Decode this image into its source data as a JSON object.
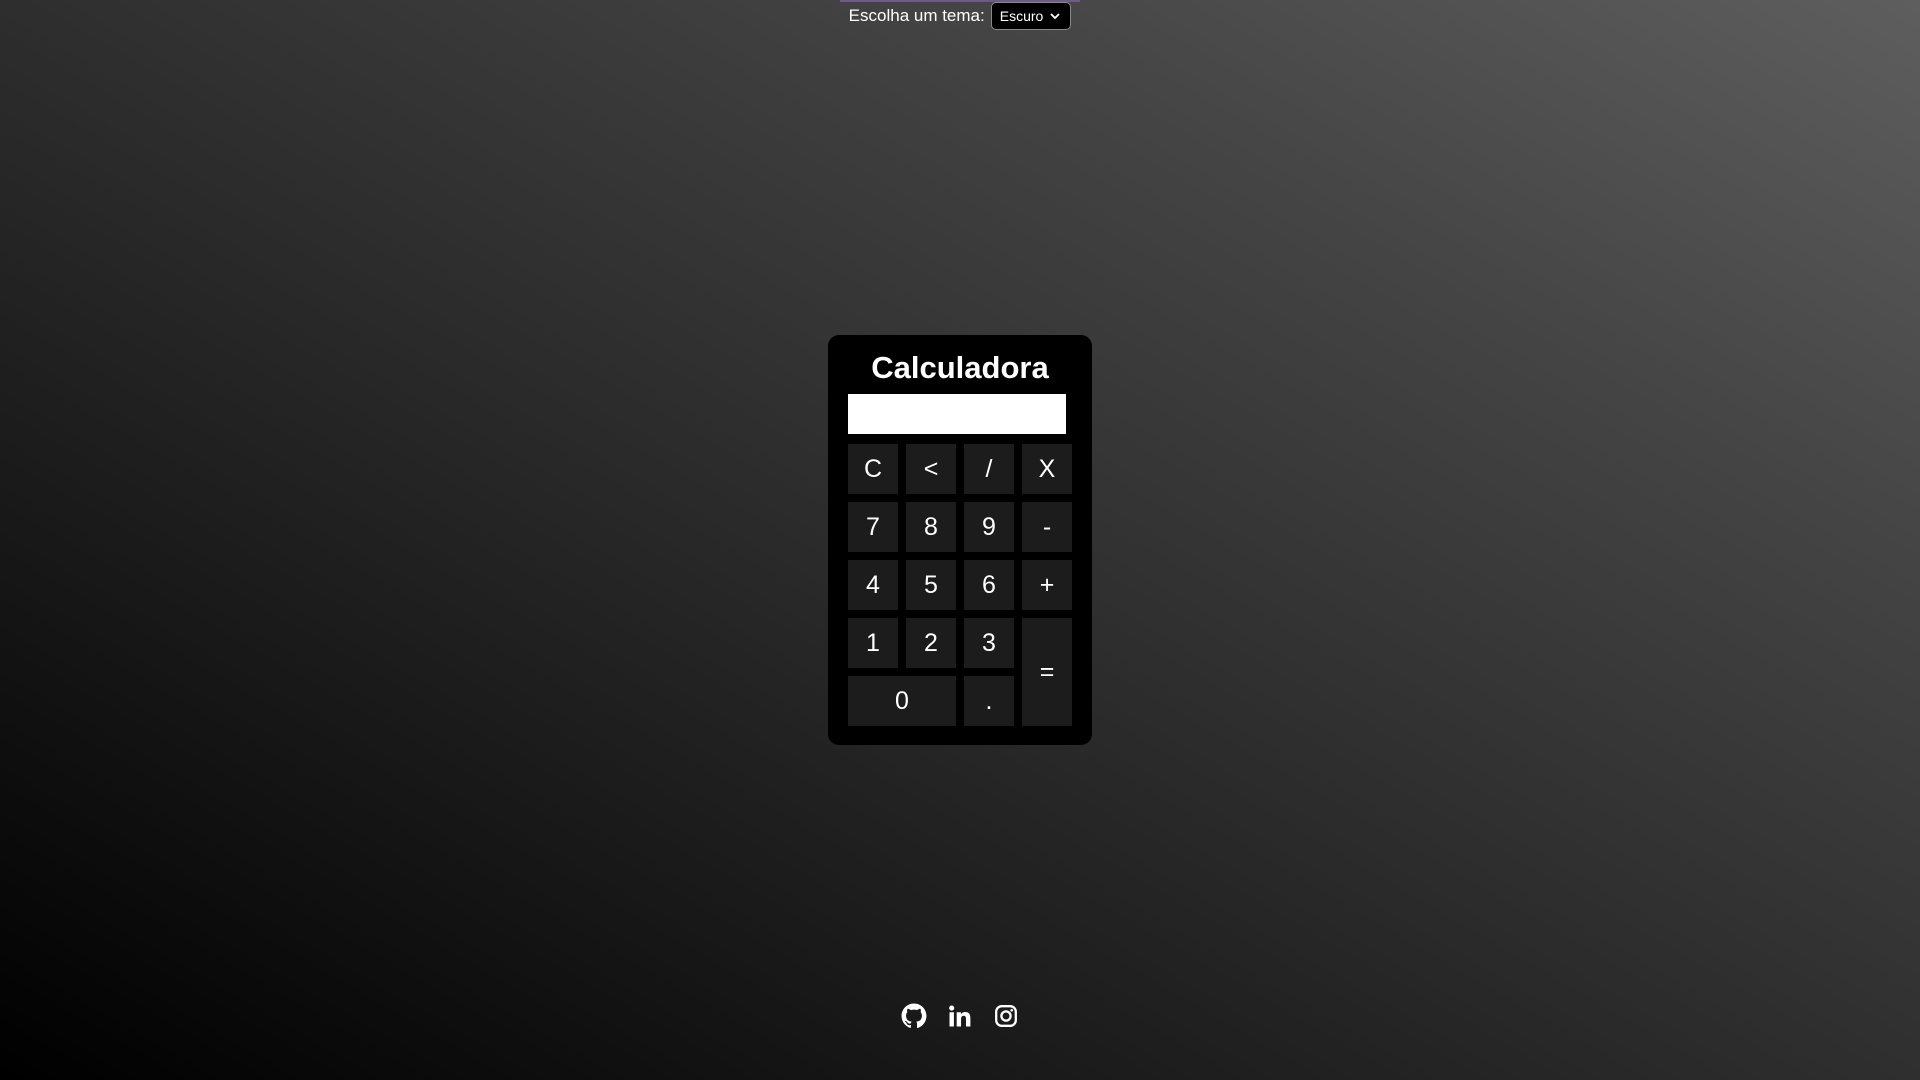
{
  "theme_bar": {
    "label": "Escolha um tema:",
    "selected": "Escuro"
  },
  "calculator": {
    "title": "Calculadora",
    "display_value": "",
    "keys": {
      "clear": "C",
      "backspace": "<",
      "divide": "/",
      "multiply": "X",
      "seven": "7",
      "eight": "8",
      "nine": "9",
      "minus": "-",
      "four": "4",
      "five": "5",
      "six": "6",
      "plus": "+",
      "one": "1",
      "two": "2",
      "three": "3",
      "equals": "=",
      "zero": "0",
      "decimal": "."
    }
  },
  "socials": [
    {
      "icon": "github-icon"
    },
    {
      "icon": "linkedin-icon"
    },
    {
      "icon": "instagram-icon"
    }
  ],
  "colors": {
    "background_dark": "#000000",
    "background_light": "#5e5e5e",
    "calculator_body": "#000000",
    "key_background": "#1c1c1c",
    "display_background": "#ffffff",
    "text": "#ffffff"
  }
}
